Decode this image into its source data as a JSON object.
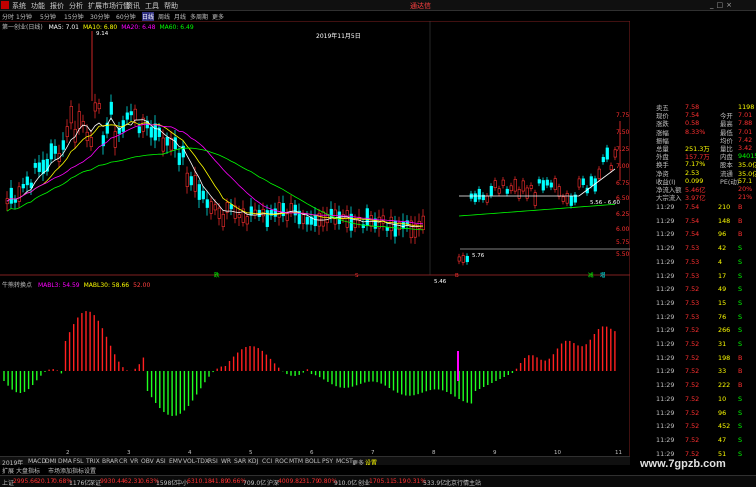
{
  "menu": {
    "items": [
      "系统",
      "功能",
      "报价",
      "分析",
      "扩展市场行情",
      "资讯",
      "工具",
      "帮助"
    ],
    "window_title": "通达信"
  },
  "periods": {
    "items": [
      "分时",
      "1分钟",
      "5分钟",
      "15分钟",
      "30分钟",
      "60分钟",
      "日线",
      "周线",
      "月线",
      "多周期",
      "更多"
    ],
    "active": 6
  },
  "main": {
    "stock_label": "第一创业(日线)",
    "ma_labels": [
      {
        "text": "MA5: 7.01",
        "color": "#ffffff"
      },
      {
        "text": "MA10: 6.80",
        "color": "#ffff00"
      },
      {
        "text": "MA20: 6.48",
        "color": "#ff00ff"
      },
      {
        "text": "MA60: 6.49",
        "color": "#00ff00"
      }
    ],
    "date_label": "2019年11月5日",
    "price_axis": [
      "7.75",
      "7.50",
      "7.25",
      "7.00",
      "6.75",
      "6.50",
      "6.25",
      "6.00",
      "5.75",
      "5.50"
    ],
    "marks": [
      {
        "text": "9.14"
      },
      {
        "text": "5.46"
      },
      {
        "text": "5.76"
      },
      {
        "text": "5.56 - 6.60"
      }
    ],
    "signals": [
      "跌",
      "S",
      "B",
      "减",
      "增"
    ]
  },
  "indicator": {
    "name": "牛熊转换点",
    "values": [
      {
        "text": "MABL3: 54.59",
        "color": "#ff00ff"
      },
      {
        "text": "MABL30: 58.66",
        "color": "#ffff00"
      },
      {
        "text": "52.00",
        "color": "#ff4040"
      }
    ],
    "axis": [
      "60.00",
      "58.00",
      "56.00",
      "54.00",
      "52.00",
      "50.00",
      "48.00",
      "46.00",
      "44.00"
    ]
  },
  "quote": {
    "rows": [
      {
        "l": "卖五",
        "v": "7.58",
        "r": "1198",
        "vc": "#ff3030",
        "rc": "#ffff00"
      },
      {
        "l": "现价",
        "v": "7.54",
        "r2": "今开",
        "r": "7.01",
        "vc": "#ff3030",
        "rc": "#ff3030"
      },
      {
        "l": "涨跌",
        "v": "0.58",
        "r2": "最高",
        "r": "7.88",
        "vc": "#ff3030",
        "rc": "#ff3030"
      },
      {
        "l": "涨幅",
        "v": "8.33%",
        "r2": "最低",
        "r": "7.01",
        "vc": "#ff3030",
        "rc": "#ff3030"
      },
      {
        "l": "振幅",
        "v": "",
        "r2": "均价",
        "r": "7.42",
        "vc": "#ff3030",
        "rc": "#ff3030"
      },
      {
        "l": "总量",
        "v": "251.3万",
        "r2": "量比",
        "r": "3.42",
        "vc": "#ffff00",
        "rc": "#ff3030"
      },
      {
        "l": "外盘",
        "v": "157.7万",
        "r2": "内盘",
        "r": "94015.9",
        "vc": "#ff3030",
        "rc": "#00ff00"
      },
      {
        "l": "换手",
        "v": "7.17%",
        "r2": "股本",
        "r": "35.0亿",
        "vc": "#ffff00",
        "rc": "#ffff00"
      },
      {
        "l": "净资",
        "v": "2.53",
        "r2": "流通",
        "r": "35.0亿",
        "vc": "#ffff00",
        "rc": "#ffff00"
      },
      {
        "l": "收益(I)",
        "v": "0.099",
        "r2": "PE(动)",
        "r": "57.1",
        "vc": "#ffff00",
        "rc": "#ffff00"
      },
      {
        "l": "净流入额",
        "v": "5.46亿",
        "r": "20%",
        "vc": "#ff3030",
        "rc": "#ff3030"
      },
      {
        "l": "大宗流入",
        "v": "3.97亿",
        "r": "21%",
        "vc": "#ff3030",
        "rc": "#ff3030"
      }
    ],
    "ticks": [
      {
        "t": "11:29",
        "p": "7.54",
        "v": "210",
        "s": "B"
      },
      {
        "t": "11:29",
        "p": "7.54",
        "v": "148",
        "s": "B"
      },
      {
        "t": "11:29",
        "p": "7.54",
        "v": "96",
        "s": "B"
      },
      {
        "t": "11:29",
        "p": "7.53",
        "v": "42",
        "s": "S"
      },
      {
        "t": "11:29",
        "p": "7.53",
        "v": "4",
        "s": "S"
      },
      {
        "t": "11:29",
        "p": "7.53",
        "v": "17",
        "s": "S"
      },
      {
        "t": "11:29",
        "p": "7.52",
        "v": "49",
        "s": "S"
      },
      {
        "t": "11:29",
        "p": "7.53",
        "v": "15",
        "s": "S"
      },
      {
        "t": "11:29",
        "p": "7.53",
        "v": "76",
        "s": "S"
      },
      {
        "t": "11:29",
        "p": "7.52",
        "v": "266",
        "s": "S"
      },
      {
        "t": "11:29",
        "p": "7.52",
        "v": "31",
        "s": "S"
      },
      {
        "t": "11:29",
        "p": "7.52",
        "v": "198",
        "s": "B"
      },
      {
        "t": "11:29",
        "p": "7.52",
        "v": "33",
        "s": "B"
      },
      {
        "t": "11:29",
        "p": "7.52",
        "v": "222",
        "s": "B"
      },
      {
        "t": "11:29",
        "p": "7.52",
        "v": "10",
        "s": "S"
      },
      {
        "t": "11:29",
        "p": "7.52",
        "v": "96",
        "s": "S"
      },
      {
        "t": "11:29",
        "p": "7.52",
        "v": "452",
        "s": "S"
      },
      {
        "t": "11:29",
        "p": "7.52",
        "v": "47",
        "s": "S"
      },
      {
        "t": "11:29",
        "p": "7.52",
        "v": "51",
        "s": "S"
      }
    ]
  },
  "tabs": {
    "items": [
      "指标",
      "窗口",
      "MACD",
      "DMI",
      "DMA",
      "FSL",
      "TRIX",
      "BRAR",
      "CR",
      "VR",
      "OBV",
      "ASI",
      "EMV",
      "VOL-TDX",
      "RSI",
      "WR",
      "SAR",
      "KDJ",
      "CCI",
      "ROC",
      "MTM",
      "BOLL",
      "PSY",
      "MCST",
      "更多",
      "设置"
    ],
    "year": "2019年"
  },
  "subbar": {
    "items": [
      "扩展",
      "大盘指标",
      "市场",
      "添加指标设置"
    ]
  },
  "status": {
    "items": [
      {
        "text": "上证",
        "c": "#c0c0c0"
      },
      {
        "text": "2995.66",
        "c": "#ff3030"
      },
      {
        "text": "20.17",
        "c": "#ff3030"
      },
      {
        "text": "0.68%",
        "c": "#ff3030"
      },
      {
        "text": "1176亿",
        "c": "#c0c0c0"
      },
      {
        "text": "深证",
        "c": "#c0c0c0"
      },
      {
        "text": "9930.44",
        "c": "#ff3030"
      },
      {
        "text": "62.31",
        "c": "#ff3030"
      },
      {
        "text": "0.63%",
        "c": "#ff3030"
      },
      {
        "text": "1598亿",
        "c": "#c0c0c0"
      },
      {
        "text": "中小",
        "c": "#c0c0c0"
      },
      {
        "text": "6310.18",
        "c": "#ff3030"
      },
      {
        "text": "41.89",
        "c": "#ff3030"
      },
      {
        "text": "0.66%",
        "c": "#ff3030"
      },
      {
        "text": "709.0亿",
        "c": "#c0c0c0"
      },
      {
        "text": "沪深",
        "c": "#c0c0c0"
      },
      {
        "text": "4009.82",
        "c": "#ff3030"
      },
      {
        "text": "31.79",
        "c": "#ff3030"
      },
      {
        "text": "0.80%",
        "c": "#ff3030"
      },
      {
        "text": "910.0亿",
        "c": "#c0c0c0"
      },
      {
        "text": "创业",
        "c": "#c0c0c0"
      },
      {
        "text": "1705.11",
        "c": "#ff3030"
      },
      {
        "text": "5.19",
        "c": "#ff3030"
      },
      {
        "text": "0.31%",
        "c": "#ff3030"
      },
      {
        "text": "533.9亿",
        "c": "#c0c0c0"
      },
      {
        "text": "北京行情主站",
        "c": "#c0c0c0"
      }
    ]
  },
  "watermark": "www.7gpzb.com",
  "colors": {
    "up": "#ff3030",
    "down": "#00ffff",
    "ma5": "#ffffff",
    "ma10": "#ffff00",
    "ma20": "#ff00ff",
    "ma60": "#00ff00",
    "bull_bar": "#ff2020",
    "bear_bar": "#20ff20"
  }
}
